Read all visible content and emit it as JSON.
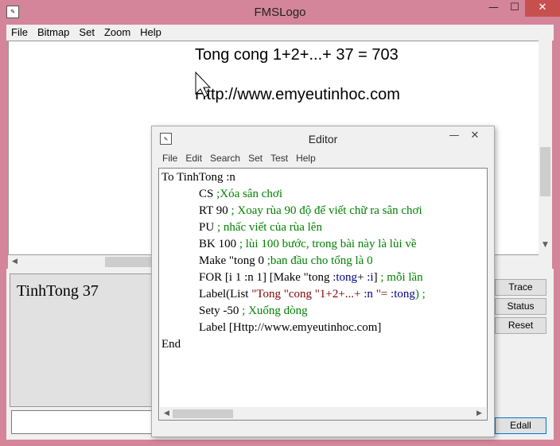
{
  "window": {
    "title": "FMSLogo",
    "minimize": "—",
    "maximize": "☐",
    "close": "✕"
  },
  "menu": [
    "File",
    "Bitmap",
    "Set",
    "Zoom",
    "Help"
  ],
  "canvas": {
    "line1": "Tong cong 1+2+...+ 37 = 703",
    "line2": "Http://www.emyeutinhoc.com"
  },
  "history": {
    "text": "TinhTong 37"
  },
  "buttons": {
    "trace": "Trace",
    "status": "Status",
    "reset": "Reset",
    "edall": "Edall"
  },
  "command_input": {
    "value": ""
  },
  "editor": {
    "title": "Editor",
    "minimize": "—",
    "close": "✕",
    "menu": [
      "File",
      "Edit",
      "Search",
      "Set",
      "Test",
      "Help"
    ],
    "code": {
      "l1": "To TinhTong :n",
      "l2a": "CS ",
      "l2b": ";Xóa sân chơi",
      "l3a": "RT 90 ",
      "l3b": "; Xoay rùa 90 độ để viết chữ ra sân chơi",
      "l4a": "PU ",
      "l4b": "; nhấc viết của rùa lên",
      "l5a": "BK 100 ",
      "l5b": "; lùi 100 bước, trong bài này là lùi về",
      "l6a": "Make \"tong 0 ",
      "l6b": ";ban đầu cho tổng là 0",
      "l7a": "FOR [i 1 :n 1] [Make \"tong ",
      "l7b": ":tong",
      "l7c": "+ ",
      "l7d": ":i",
      "l7e": "] ",
      "l7f": "; mỗi lần",
      "l8a": "Label(List ",
      "l8b": "\"Tong \"cong \"1+2+...+ ",
      "l8c": ":n",
      "l8d": " \"= ",
      "l8e": ":tong",
      "l8f": ") ;",
      "l9a": "Sety -50 ",
      "l9b": "; Xuống dòng",
      "l10": "Label [Http://www.emyeutinhoc.com]",
      "l11": "End"
    }
  }
}
